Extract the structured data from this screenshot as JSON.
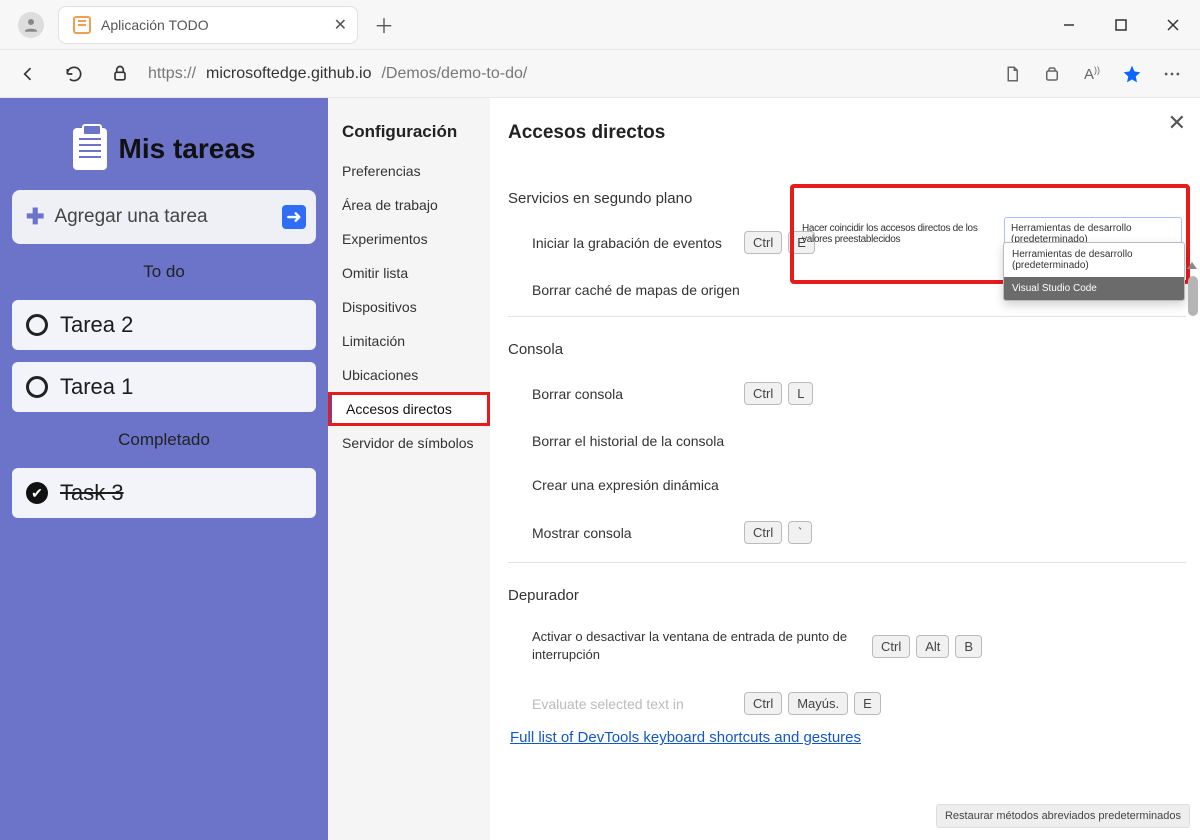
{
  "browser": {
    "tab_title": "Aplicación TODO",
    "url_prefix": "https://",
    "url_host": "microsoftedge.github.io",
    "url_path": "/Demos/demo-to-do/"
  },
  "todo": {
    "title": "Mis tareas",
    "add_placeholder": "Agregar una tarea",
    "todo_label": "To do",
    "done_label": "Completado",
    "tasks": [
      {
        "label": "Tarea 2"
      },
      {
        "label": "Tarea 1"
      }
    ],
    "done_tasks": [
      {
        "label": "Task 3"
      }
    ]
  },
  "settings_nav": {
    "title": "Configuración",
    "items": [
      "Preferencias",
      "Área de trabajo",
      "Experimentos",
      "Omitir lista",
      "Dispositivos",
      "Limitación",
      "Ubicaciones",
      "Accesos directos",
      "Servidor de símbolos"
    ],
    "active_index": 7
  },
  "shortcuts": {
    "title": "Accesos directos",
    "match_label": "Hacer coincidir los accesos directos de los valores preestablecidos",
    "dropdown_value": "Herramientas de desarrollo (predeterminado)",
    "dropdown_options": [
      "Herramientas de desarrollo (predeterminado)",
      "Visual Studio Code"
    ],
    "groups": [
      {
        "name": "Servicios en segundo plano",
        "rows": [
          {
            "text": "Iniciar la grabación de eventos",
            "keys": [
              "Ctrl",
              "E"
            ]
          },
          {
            "text": "Borrar caché de mapas de origen",
            "keys": []
          }
        ]
      },
      {
        "name": "Consola",
        "rows": [
          {
            "text": "Borrar consola",
            "keys": [
              "Ctrl",
              "L"
            ]
          },
          {
            "text": "Borrar el historial de la consola",
            "keys": []
          },
          {
            "text": "Crear una expresión dinámica",
            "keys": []
          },
          {
            "text": "Mostrar consola",
            "keys": [
              "Ctrl",
              "`"
            ]
          }
        ]
      },
      {
        "name": "Depurador",
        "rows": [
          {
            "text": "Activar o desactivar la ventana de entrada de punto de interrupción",
            "keys": [
              "Ctrl",
              "Alt",
              "B"
            ],
            "wide": true
          },
          {
            "text": "Evaluate selected text in",
            "keys": [
              "Ctrl",
              "Mayús.",
              "E"
            ],
            "faded": true
          }
        ]
      }
    ],
    "footer_link": "Full list of DevTools keyboard shortcuts and gestures",
    "restore_btn": "Restaurar métodos abreviados predeterminados"
  }
}
